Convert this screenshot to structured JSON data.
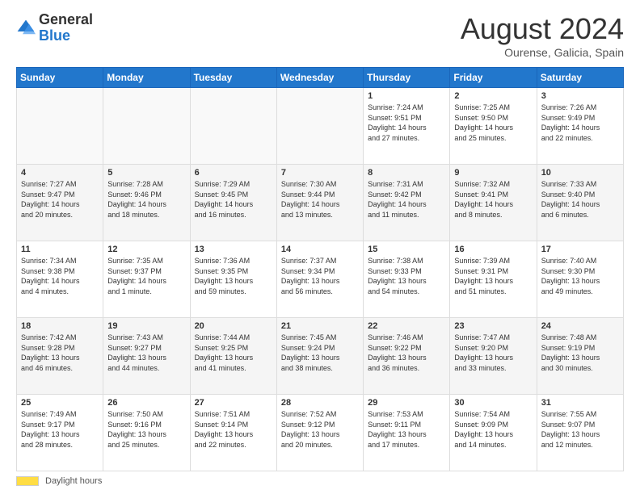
{
  "logo": {
    "general": "General",
    "blue": "Blue"
  },
  "title": "August 2024",
  "subtitle": "Ourense, Galicia, Spain",
  "days_of_week": [
    "Sunday",
    "Monday",
    "Tuesday",
    "Wednesday",
    "Thursday",
    "Friday",
    "Saturday"
  ],
  "footer": {
    "label": "Daylight hours"
  },
  "weeks": [
    {
      "days": [
        {
          "num": "",
          "info": ""
        },
        {
          "num": "",
          "info": ""
        },
        {
          "num": "",
          "info": ""
        },
        {
          "num": "",
          "info": ""
        },
        {
          "num": "1",
          "info": "Sunrise: 7:24 AM\nSunset: 9:51 PM\nDaylight: 14 hours\nand 27 minutes."
        },
        {
          "num": "2",
          "info": "Sunrise: 7:25 AM\nSunset: 9:50 PM\nDaylight: 14 hours\nand 25 minutes."
        },
        {
          "num": "3",
          "info": "Sunrise: 7:26 AM\nSunset: 9:49 PM\nDaylight: 14 hours\nand 22 minutes."
        }
      ]
    },
    {
      "days": [
        {
          "num": "4",
          "info": "Sunrise: 7:27 AM\nSunset: 9:47 PM\nDaylight: 14 hours\nand 20 minutes."
        },
        {
          "num": "5",
          "info": "Sunrise: 7:28 AM\nSunset: 9:46 PM\nDaylight: 14 hours\nand 18 minutes."
        },
        {
          "num": "6",
          "info": "Sunrise: 7:29 AM\nSunset: 9:45 PM\nDaylight: 14 hours\nand 16 minutes."
        },
        {
          "num": "7",
          "info": "Sunrise: 7:30 AM\nSunset: 9:44 PM\nDaylight: 14 hours\nand 13 minutes."
        },
        {
          "num": "8",
          "info": "Sunrise: 7:31 AM\nSunset: 9:42 PM\nDaylight: 14 hours\nand 11 minutes."
        },
        {
          "num": "9",
          "info": "Sunrise: 7:32 AM\nSunset: 9:41 PM\nDaylight: 14 hours\nand 8 minutes."
        },
        {
          "num": "10",
          "info": "Sunrise: 7:33 AM\nSunset: 9:40 PM\nDaylight: 14 hours\nand 6 minutes."
        }
      ]
    },
    {
      "days": [
        {
          "num": "11",
          "info": "Sunrise: 7:34 AM\nSunset: 9:38 PM\nDaylight: 14 hours\nand 4 minutes."
        },
        {
          "num": "12",
          "info": "Sunrise: 7:35 AM\nSunset: 9:37 PM\nDaylight: 14 hours\nand 1 minute."
        },
        {
          "num": "13",
          "info": "Sunrise: 7:36 AM\nSunset: 9:35 PM\nDaylight: 13 hours\nand 59 minutes."
        },
        {
          "num": "14",
          "info": "Sunrise: 7:37 AM\nSunset: 9:34 PM\nDaylight: 13 hours\nand 56 minutes."
        },
        {
          "num": "15",
          "info": "Sunrise: 7:38 AM\nSunset: 9:33 PM\nDaylight: 13 hours\nand 54 minutes."
        },
        {
          "num": "16",
          "info": "Sunrise: 7:39 AM\nSunset: 9:31 PM\nDaylight: 13 hours\nand 51 minutes."
        },
        {
          "num": "17",
          "info": "Sunrise: 7:40 AM\nSunset: 9:30 PM\nDaylight: 13 hours\nand 49 minutes."
        }
      ]
    },
    {
      "days": [
        {
          "num": "18",
          "info": "Sunrise: 7:42 AM\nSunset: 9:28 PM\nDaylight: 13 hours\nand 46 minutes."
        },
        {
          "num": "19",
          "info": "Sunrise: 7:43 AM\nSunset: 9:27 PM\nDaylight: 13 hours\nand 44 minutes."
        },
        {
          "num": "20",
          "info": "Sunrise: 7:44 AM\nSunset: 9:25 PM\nDaylight: 13 hours\nand 41 minutes."
        },
        {
          "num": "21",
          "info": "Sunrise: 7:45 AM\nSunset: 9:24 PM\nDaylight: 13 hours\nand 38 minutes."
        },
        {
          "num": "22",
          "info": "Sunrise: 7:46 AM\nSunset: 9:22 PM\nDaylight: 13 hours\nand 36 minutes."
        },
        {
          "num": "23",
          "info": "Sunrise: 7:47 AM\nSunset: 9:20 PM\nDaylight: 13 hours\nand 33 minutes."
        },
        {
          "num": "24",
          "info": "Sunrise: 7:48 AM\nSunset: 9:19 PM\nDaylight: 13 hours\nand 30 minutes."
        }
      ]
    },
    {
      "days": [
        {
          "num": "25",
          "info": "Sunrise: 7:49 AM\nSunset: 9:17 PM\nDaylight: 13 hours\nand 28 minutes."
        },
        {
          "num": "26",
          "info": "Sunrise: 7:50 AM\nSunset: 9:16 PM\nDaylight: 13 hours\nand 25 minutes."
        },
        {
          "num": "27",
          "info": "Sunrise: 7:51 AM\nSunset: 9:14 PM\nDaylight: 13 hours\nand 22 minutes."
        },
        {
          "num": "28",
          "info": "Sunrise: 7:52 AM\nSunset: 9:12 PM\nDaylight: 13 hours\nand 20 minutes."
        },
        {
          "num": "29",
          "info": "Sunrise: 7:53 AM\nSunset: 9:11 PM\nDaylight: 13 hours\nand 17 minutes."
        },
        {
          "num": "30",
          "info": "Sunrise: 7:54 AM\nSunset: 9:09 PM\nDaylight: 13 hours\nand 14 minutes."
        },
        {
          "num": "31",
          "info": "Sunrise: 7:55 AM\nSunset: 9:07 PM\nDaylight: 13 hours\nand 12 minutes."
        }
      ]
    }
  ]
}
